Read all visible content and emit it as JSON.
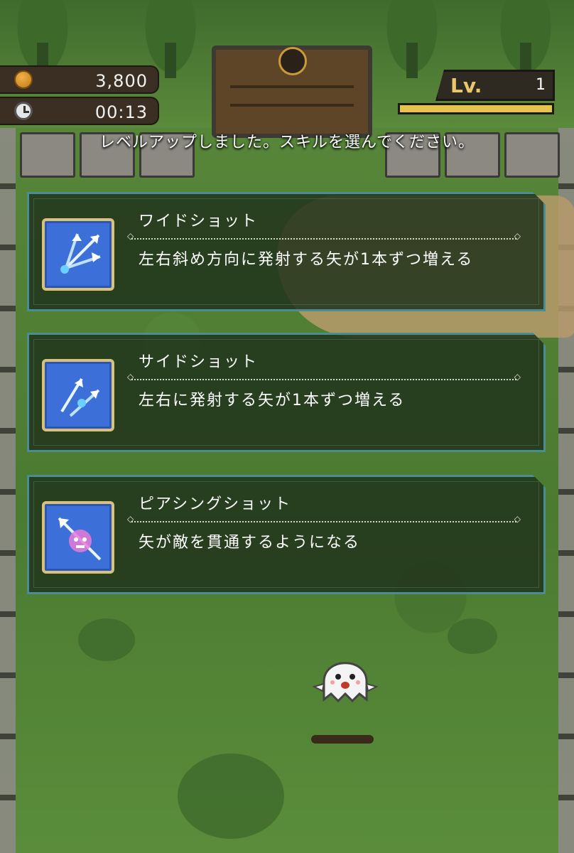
{
  "hud": {
    "coins": "3,800",
    "timer": "00:13",
    "level_label": "Lv.",
    "level_value": "1",
    "xp_progress": 1.0,
    "coin_icon": "coin-icon",
    "timer_icon": "clock-icon"
  },
  "prompt": "レベルアップしました。スキルを選んでください。",
  "skills": [
    {
      "title": "ワイドショット",
      "description": "左右斜め方向に発射する矢が1本ずつ増える",
      "icon": "wide-shot-icon"
    },
    {
      "title": "サイドショット",
      "description": "左右に発射する矢が1本ずつ増える",
      "icon": "side-shot-icon"
    },
    {
      "title": "ピアシングショット",
      "description": "矢が敵を貫通するようになる",
      "icon": "piercing-shot-icon"
    }
  ],
  "colors": {
    "card_border": "#4a8d92",
    "icon_bg": "#3c6fd8",
    "icon_frame": "#d9c27a",
    "level_label": "#e8c86a",
    "xp_fill": "#e4c44c"
  }
}
